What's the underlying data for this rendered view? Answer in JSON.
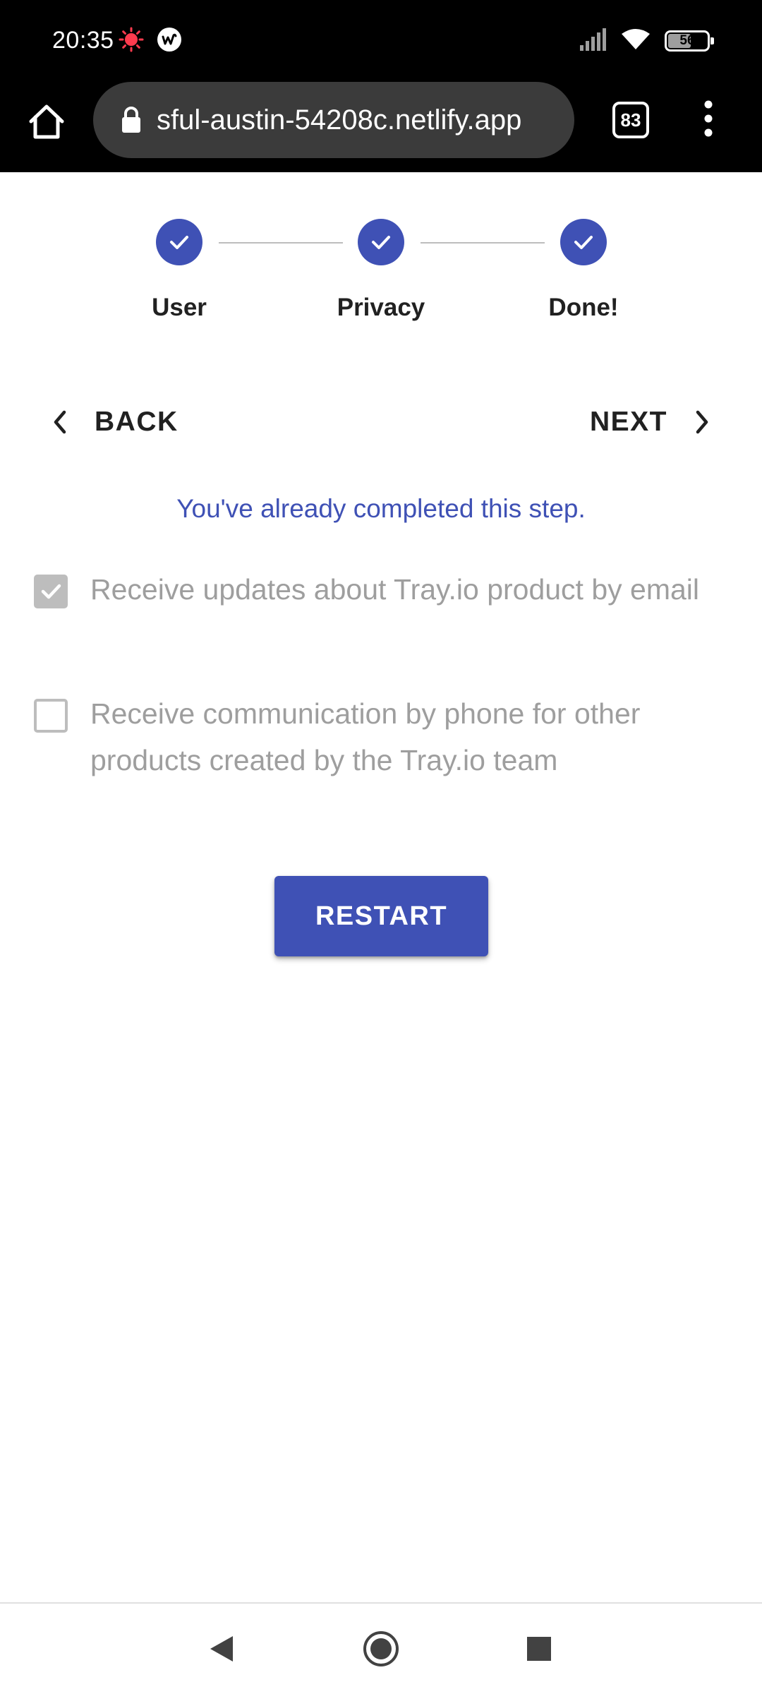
{
  "status_bar": {
    "time": "20:35",
    "battery_level": "56",
    "icons": [
      "record-indicator-icon",
      "app-notification-icon",
      "signal-icon",
      "wifi-icon",
      "battery-icon"
    ]
  },
  "browser": {
    "url": "sful-austin-54208c.netlify.app",
    "tab_count": "83",
    "icons": [
      "home-icon",
      "lock-icon",
      "tabs-icon",
      "more-vert-icon"
    ]
  },
  "stepper": {
    "steps": [
      {
        "label": "User",
        "state": "completed"
      },
      {
        "label": "Privacy",
        "state": "completed"
      },
      {
        "label": "Done!",
        "state": "completed"
      }
    ],
    "accent_color": "#3f51b5"
  },
  "navigation": {
    "back_label": "BACK",
    "next_label": "NEXT"
  },
  "info": {
    "message": "You've already completed this step."
  },
  "consents": [
    {
      "label": "Receive updates about Tray.io product by email",
      "checked": true,
      "disabled": true
    },
    {
      "label": "Receive communication by phone for other products created by the Tray.io team",
      "checked": false,
      "disabled": true
    }
  ],
  "actions": {
    "restart_label": "RESTART"
  },
  "system_nav": {
    "icons": [
      "back-triangle-icon",
      "home-circle-icon",
      "recents-square-icon"
    ]
  }
}
